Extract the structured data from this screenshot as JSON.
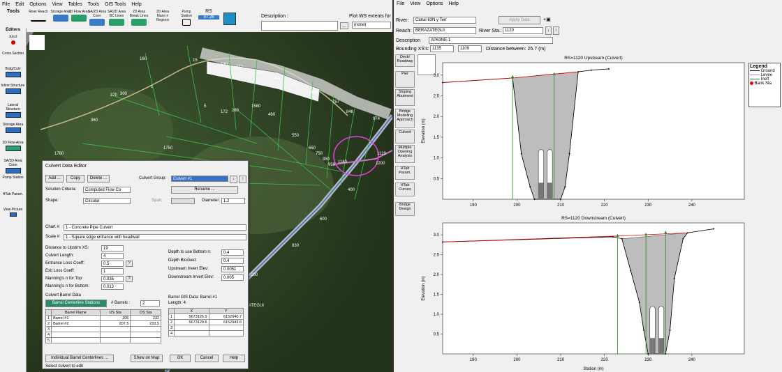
{
  "left_menu": [
    "File",
    "Edit",
    "Options",
    "View",
    "Tables",
    "Tools",
    "GIS Tools",
    "Help"
  ],
  "toolbar": {
    "tools": "Tools",
    "river_reach": "River Reach",
    "storage": "Storage Area",
    "flow2d": "2D Flow Area",
    "sa2d_conn": "SA/2D Area Conn",
    "sa2d_bc": "SA/2D Area BC Lines",
    "flow2d_lines": "2D Area Break Lines",
    "flow2d_mann": "2D Area Mann n Regions",
    "pump": "Pump Station",
    "rs": "RS",
    "rs_value": "97.28",
    "description_label": "Description :",
    "plot_ws": "Plot WS extents for",
    "none": "(none)"
  },
  "editors": {
    "title": "Editors",
    "items": [
      "Junct",
      "Cross Section",
      "Brdg/Culv",
      "Inline Structure",
      "Lateral Structure",
      "Storage Area",
      "2D Flow Area",
      "SA/2D Area Conn",
      "Pump Station",
      "HTab Param.",
      "View Picture"
    ]
  },
  "map_labels": [
    "160",
    "15",
    "130",
    "237",
    "344",
    "443",
    "531",
    "645",
    "757",
    "848",
    "974",
    "1",
    "300",
    "5",
    "172",
    "260",
    "1580",
    "460",
    "550",
    "650",
    "750",
    "850",
    "950",
    "1180",
    "1120",
    "1200",
    "370",
    "400",
    "600",
    "360",
    "1750",
    "1780",
    "830",
    "1000",
    "120",
    "BERAZATEGUI"
  ],
  "dialog": {
    "title": "Culvert Data Editor",
    "add": "Add ...",
    "copy": "Copy",
    "delete": "Delete ...",
    "culvert_group_label": "Culvert Group:",
    "culvert_group": "Culvert #1",
    "rename": "Rename ...",
    "solution_label": "Solution Criteria:",
    "solution": "Computed Flow Co",
    "shape_label": "Shape:",
    "shape": "Circular",
    "span_label": "Span:",
    "diameter_label": "Diameter:",
    "diameter": "1.2",
    "chart_label": "Chart #:",
    "chart": "1 - Concrete Pipe Culvert",
    "scale_label": "Scale #:",
    "scale": "1 - Square edge entrance with headwall",
    "fields_left": [
      {
        "label": "Distance to Upstrm XS:",
        "value": "19"
      },
      {
        "label": "Culvert Length:",
        "value": "4"
      },
      {
        "label": "Entrance Loss Coeff:",
        "value": "0.5"
      },
      {
        "label": "Exit Loss Coeff:",
        "value": "1"
      },
      {
        "label": "Manning's n for Top:",
        "value": "0.035"
      },
      {
        "label": "Manning's n for Bottom:",
        "value": "0.013"
      }
    ],
    "fields_right": [
      {
        "label": "Depth to use Bottom n:",
        "value": "0.4"
      },
      {
        "label": "Depth Blocked:",
        "value": "0.4"
      },
      {
        "label": "Upstream Invert Elev:",
        "value": "0.0051"
      },
      {
        "label": "Downstream Invert Elev:",
        "value": "0.005"
      }
    ],
    "barrel_section": "Culvert Barrel Data",
    "barrel_tab": "Barrel Centerline Stations",
    "barrels_label": "# Barrels :",
    "barrels": "2",
    "barrel_headers": [
      "Barrel Name",
      "US Sta",
      "DS Sta"
    ],
    "barrel_rows": [
      [
        "1",
        "Barrel #1",
        "206",
        "232"
      ],
      [
        "2",
        "Barrel #2",
        "207.5",
        "233.5"
      ],
      [
        "3",
        "",
        "",
        ""
      ],
      [
        "4",
        "",
        "",
        ""
      ],
      [
        "5",
        "",
        "",
        ""
      ]
    ],
    "gis_title": "Barrel GIS Data: Barrel #1",
    "gis_length": "Length: 4",
    "gis_headers": [
      "X",
      "Y"
    ],
    "gis_rows": [
      [
        "1",
        "5673126.9",
        "6152940.7"
      ],
      [
        "2",
        "5673129.6",
        "6152943.6"
      ],
      [
        "3",
        "",
        ""
      ],
      [
        "4",
        "",
        ""
      ]
    ],
    "individual": "Individual Barrel Centerlines ...",
    "show_map": "Show on Map",
    "ok": "OK",
    "cancel": "Cancel",
    "help": "Help",
    "status": "Select culvert to edit"
  },
  "right": {
    "menu": [
      "File",
      "View",
      "Options",
      "Help"
    ],
    "river_label": "River:",
    "river": "Canal 63N y Terr",
    "apply": "Apply Data",
    "reach_label": "Reach:",
    "reach": "BERAZATEGUI",
    "rs_label": "River Sta.:",
    "rs": "1120",
    "desc_label": "Description",
    "desc": "AP63NE-1",
    "bounding_label": "Bounding XS's:",
    "bounding_us": "1135",
    "bounding_ds": "1109",
    "distance": "Distance between: 25.7 (m)",
    "side": [
      "Deck/ Roadway",
      "Pier",
      "Sloping Abutment",
      "Bridge Modeling Approach",
      "Culvert",
      "Multiple Opening Analysis",
      "HTab Param.",
      "HTab Curves",
      "Bridge Design"
    ],
    "legend": {
      "title": "Legend",
      "items": [
        "Ground",
        "Levee",
        "Ineff",
        "Bank Sta"
      ]
    }
  },
  "chart_data": [
    {
      "type": "line",
      "title": "RS=1120   Upstream  (Culvert)",
      "xlabel": "",
      "ylabel": "Elevation (m)",
      "xlim": [
        183,
        252
      ],
      "ylim": [
        0,
        3.3
      ],
      "xticks": [
        190,
        200,
        210,
        220,
        230,
        240
      ],
      "yticks": [
        0.5,
        1.0,
        1.5,
        2.0,
        2.5,
        3.0
      ],
      "ground": [
        [
          183,
          2.82
        ],
        [
          199,
          2.93
        ],
        [
          201,
          1.1
        ],
        [
          203,
          0.3
        ],
        [
          204,
          0
        ],
        [
          210,
          0
        ],
        [
          211,
          0.3
        ],
        [
          212,
          1.1
        ],
        [
          214,
          3.08
        ],
        [
          217,
          3.12
        ],
        [
          221,
          3.15
        ]
      ],
      "fill": [
        [
          199,
          2.93
        ],
        [
          214,
          3.08
        ]
      ],
      "ineff_x": [
        199,
        208.5
      ],
      "ineff_y": [
        2.95,
        3.02
      ],
      "culverts": [
        {
          "center": 205.5,
          "bottom": 0,
          "top": 1.2
        },
        {
          "center": 207.5,
          "bottom": 0,
          "top": 1.2
        }
      ]
    },
    {
      "type": "line",
      "title": "RS=1120   Downstream  (Culvert)",
      "xlabel": "Station (m)",
      "ylabel": "Elevation (m)",
      "xlim": [
        183,
        252
      ],
      "ylim": [
        0,
        3.3
      ],
      "xticks": [
        190,
        200,
        210,
        220,
        230,
        240
      ],
      "yticks": [
        0.5,
        1.0,
        1.5,
        2.0,
        2.5,
        3.0
      ],
      "ground": [
        [
          183,
          2.82
        ],
        [
          222,
          2.95
        ],
        [
          224,
          2.9
        ],
        [
          226,
          2.1
        ],
        [
          228,
          1.3
        ],
        [
          229,
          0.6
        ],
        [
          230,
          0
        ],
        [
          234,
          0
        ],
        [
          235,
          0.6
        ],
        [
          236,
          1.9
        ],
        [
          238,
          2.9
        ],
        [
          239,
          3.05
        ],
        [
          245,
          3.15
        ]
      ],
      "fill": [
        [
          223,
          2.97
        ],
        [
          239,
          3.05
        ]
      ],
      "ineff_x": [
        223,
        229.5,
        234
      ],
      "ineff_y": [
        2.97,
        3.0,
        3.05
      ],
      "culverts": [
        {
          "center": 231,
          "bottom": 0,
          "top": 1.2
        },
        {
          "center": 233,
          "bottom": 0,
          "top": 1.2
        }
      ]
    }
  ]
}
